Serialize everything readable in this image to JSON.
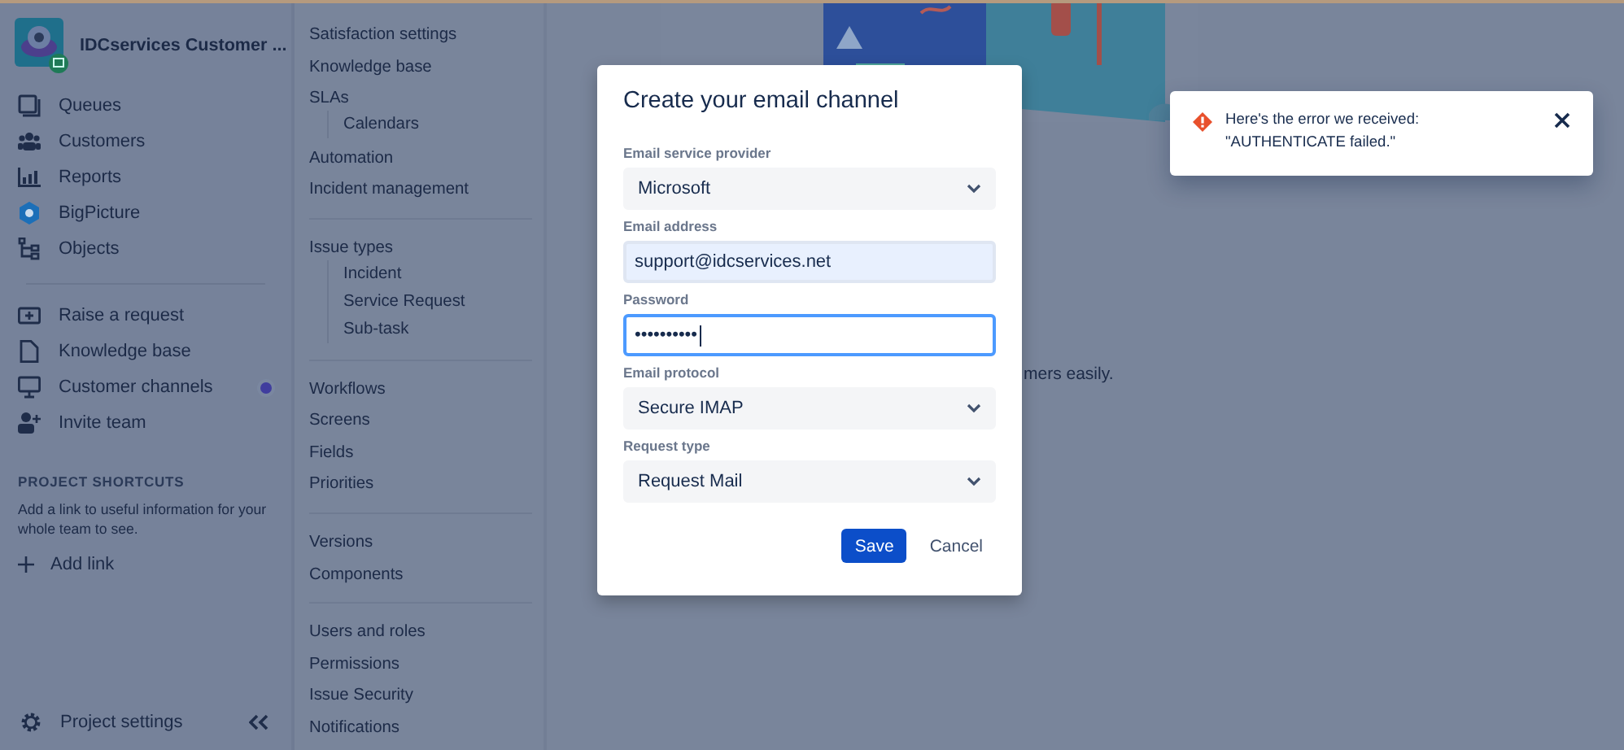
{
  "project": {
    "name": "IDCservices Customer ..."
  },
  "nav": [
    {
      "label": "Queues",
      "dot": false
    },
    {
      "label": "Customers",
      "dot": false
    },
    {
      "label": "Reports",
      "dot": false
    },
    {
      "label": "BigPicture",
      "dot": false
    },
    {
      "label": "Objects",
      "dot": false
    }
  ],
  "nav2": [
    {
      "label": "Raise a request",
      "dot": false
    },
    {
      "label": "Knowledge base",
      "dot": false
    },
    {
      "label": "Customer channels",
      "dot": true
    },
    {
      "label": "Invite team",
      "dot": false
    }
  ],
  "shortcuts": {
    "heading": "PROJECT SHORTCUTS",
    "text": "Add a link to useful information for your whole team to see.",
    "add_link": "Add link"
  },
  "project_settings": "Project settings",
  "settings_menu": [
    [
      {
        "label": "Satisfaction settings"
      },
      {
        "label": "Knowledge base"
      },
      {
        "label": "SLAs",
        "children": [
          {
            "label": "Calendars"
          }
        ]
      },
      {
        "label": "Automation"
      },
      {
        "label": "Incident management"
      }
    ],
    [
      {
        "label": "Issue types",
        "children": [
          {
            "label": "Incident"
          },
          {
            "label": "Service Request"
          },
          {
            "label": "Sub-task"
          }
        ]
      }
    ],
    [
      {
        "label": "Workflows"
      },
      {
        "label": "Screens"
      },
      {
        "label": "Fields"
      },
      {
        "label": "Priorities"
      }
    ],
    [
      {
        "label": "Versions"
      },
      {
        "label": "Components"
      }
    ],
    [
      {
        "label": "Users and roles"
      },
      {
        "label": "Permissions"
      },
      {
        "label": "Issue Security"
      },
      {
        "label": "Notifications"
      }
    ]
  ],
  "background_text": "mers easily.",
  "modal": {
    "title": "Create your email channel",
    "fields": [
      {
        "label": "Email service provider",
        "kind": "select",
        "value": "Microsoft",
        "focused": false
      },
      {
        "label": "Email address",
        "kind": "input",
        "value": "support@idcservices.net",
        "focused": false
      },
      {
        "label": "Password",
        "kind": "password",
        "value": "••••••••••",
        "focused": true
      },
      {
        "label": "Email protocol",
        "kind": "select",
        "value": "Secure IMAP",
        "focused": false
      },
      {
        "label": "Request type",
        "kind": "select",
        "value": "Request Mail",
        "focused": false
      }
    ],
    "buttons": [
      {
        "label": "Save",
        "kind": "primary"
      },
      {
        "label": "Cancel",
        "kind": "subtle"
      }
    ]
  },
  "toast": {
    "message": "Here's the error we received: \"AUTHENTICATE failed.\""
  }
}
